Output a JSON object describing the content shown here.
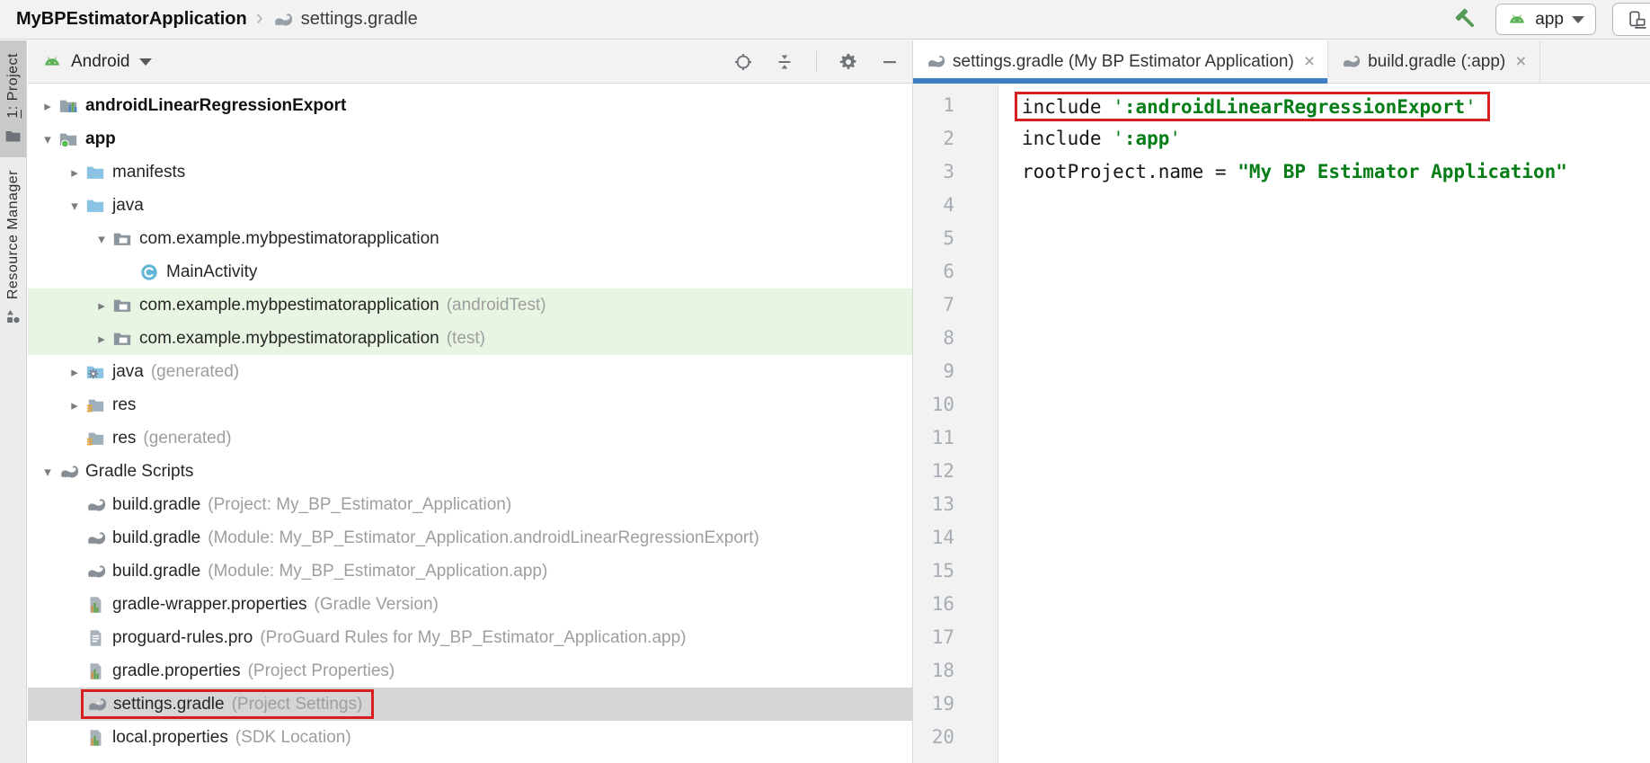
{
  "glyphs": {
    "breadcrumb_separator": "›",
    "tree_expanded": "▾",
    "tree_collapsed": "▸",
    "tab_close": "×"
  },
  "colors": {
    "accent_tab_underline": "#3d7dc4",
    "highlight_box_red": "#d81f1f",
    "tree_selection_gray": "#d5d5d5",
    "tree_highlight_green": "#e9f5e3",
    "code_string_green": "#067d17",
    "android_green": "#5cb157",
    "hammer_green": "#569b57"
  },
  "breadcrumb": {
    "project": "MyBPEstimatorApplication",
    "file": "settings.gradle"
  },
  "topbar_actions": {
    "run_config": "app"
  },
  "stripe": {
    "project_accel": "1",
    "project_rest": ": Project",
    "resource_manager": "Resource Manager"
  },
  "project_panel": {
    "view": "Android",
    "tree": [
      {
        "level": 0,
        "arrow": "collapsed",
        "icon": "module-folder-icon",
        "label": "androidLinearRegressionExport",
        "bold": true
      },
      {
        "level": 0,
        "arrow": "expanded",
        "icon": "android-app-module-icon",
        "label": "app",
        "bold": true
      },
      {
        "level": 1,
        "arrow": "collapsed",
        "icon": "folder-icon",
        "label": "manifests"
      },
      {
        "level": 1,
        "arrow": "expanded",
        "icon": "folder-icon",
        "label": "java"
      },
      {
        "level": 2,
        "arrow": "expanded",
        "icon": "package-icon",
        "label": "com.example.mybpestimatorapplication"
      },
      {
        "level": 3,
        "arrow": null,
        "icon": "class-icon",
        "label": "MainActivity"
      },
      {
        "level": 2,
        "arrow": "collapsed",
        "icon": "package-icon",
        "label": "com.example.mybpestimatorapplication",
        "annotation": "(androidTest)",
        "highlight": "green"
      },
      {
        "level": 2,
        "arrow": "collapsed",
        "icon": "package-icon",
        "label": "com.example.mybpestimatorapplication",
        "annotation": "(test)",
        "highlight": "green"
      },
      {
        "level": 1,
        "arrow": "collapsed",
        "icon": "java-generated-folder-icon",
        "label": "java",
        "annotation": "(generated)"
      },
      {
        "level": 1,
        "arrow": "collapsed",
        "icon": "res-folder-icon",
        "label": "res"
      },
      {
        "level": 1,
        "arrow": null,
        "icon": "res-folder-icon",
        "label": "res",
        "annotation": "(generated)"
      },
      {
        "level": 0,
        "arrow": "expanded",
        "icon": "gradle-icon",
        "label": "Gradle Scripts"
      },
      {
        "level": 1,
        "arrow": null,
        "icon": "gradle-icon",
        "label": "build.gradle",
        "annotation": "(Project: My_BP_Estimator_Application)"
      },
      {
        "level": 1,
        "arrow": null,
        "icon": "gradle-icon",
        "label": "build.gradle",
        "annotation": "(Module: My_BP_Estimator_Application.androidLinearRegressionExport)"
      },
      {
        "level": 1,
        "arrow": null,
        "icon": "gradle-icon",
        "label": "build.gradle",
        "annotation": "(Module: My_BP_Estimator_Application.app)"
      },
      {
        "level": 1,
        "arrow": null,
        "icon": "properties-file-icon",
        "label": "gradle-wrapper.properties",
        "annotation": "(Gradle Version)"
      },
      {
        "level": 1,
        "arrow": null,
        "icon": "text-file-icon",
        "label": "proguard-rules.pro",
        "annotation": "(ProGuard Rules for My_BP_Estimator_Application.app)"
      },
      {
        "level": 1,
        "arrow": null,
        "icon": "properties-file-icon",
        "label": "gradle.properties",
        "annotation": "(Project Properties)"
      },
      {
        "level": 1,
        "arrow": null,
        "icon": "gradle-icon",
        "label": "settings.gradle",
        "annotation": "(Project Settings)",
        "highlight": "selected",
        "redbox": true
      },
      {
        "level": 1,
        "arrow": null,
        "icon": "properties-file-icon",
        "label": "local.properties",
        "annotation": "(SDK Location)"
      }
    ]
  },
  "editor": {
    "tabs": [
      {
        "title": "settings.gradle (My BP Estimator Application)",
        "active": true
      },
      {
        "title": "build.gradle (:app)",
        "active": false
      }
    ],
    "line_count": 20,
    "lines": [
      {
        "num": 1,
        "redbox": true,
        "segments": [
          {
            "style": "plain",
            "text": "include "
          },
          {
            "style": "string",
            "text": "'"
          },
          {
            "style": "string_bold",
            "text": ":androidLinearRegressionExport"
          },
          {
            "style": "string",
            "text": "'"
          }
        ]
      },
      {
        "num": 2,
        "segments": [
          {
            "style": "plain",
            "text": "include "
          },
          {
            "style": "string",
            "text": "'"
          },
          {
            "style": "string_bold",
            "text": ":app"
          },
          {
            "style": "string",
            "text": "'"
          }
        ]
      },
      {
        "num": 3,
        "segments": [
          {
            "style": "plain",
            "text": "rootProject.name = "
          },
          {
            "style": "string_bold",
            "text": "\"My BP Estimator Application\""
          }
        ]
      }
    ]
  }
}
